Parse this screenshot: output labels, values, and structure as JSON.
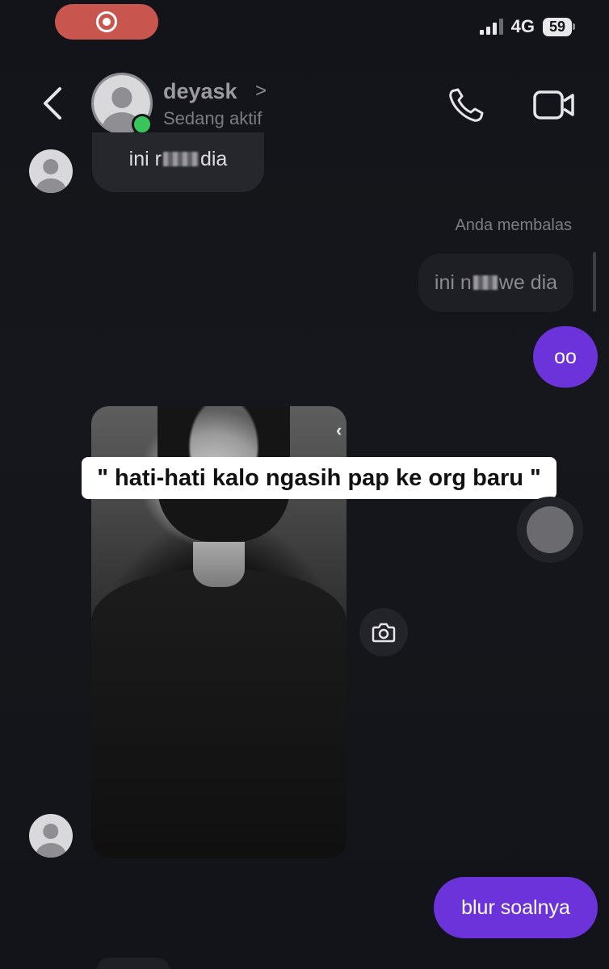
{
  "status_bar": {
    "network": "4G",
    "battery": "59"
  },
  "header": {
    "contact_name": "deyask",
    "name_chevron": ">",
    "contact_status": "Sedang aktif",
    "icons": [
      "back-icon",
      "phone-icon",
      "video-call-icon"
    ]
  },
  "messages": [
    {
      "type": "incoming",
      "text_before": "ini r",
      "text_after": "dia",
      "censored": true
    },
    {
      "type": "reply_label",
      "text": "Anda membalas"
    },
    {
      "type": "reply_quote",
      "text_before": "ini n",
      "text_after": "we dia",
      "censored": true
    },
    {
      "type": "outgoing",
      "text": "oo"
    },
    {
      "type": "incoming_photo",
      "caption": "\" hati-hati kalo ngasih pap ke org baru \""
    },
    {
      "type": "outgoing",
      "text": "blur soalnya"
    }
  ],
  "colors": {
    "background": "#121419",
    "outgoing_bubble": "#6b33d9",
    "incoming_bubble": "#25272c",
    "online": "#3ac45c",
    "record_pill": "#c9554f"
  }
}
